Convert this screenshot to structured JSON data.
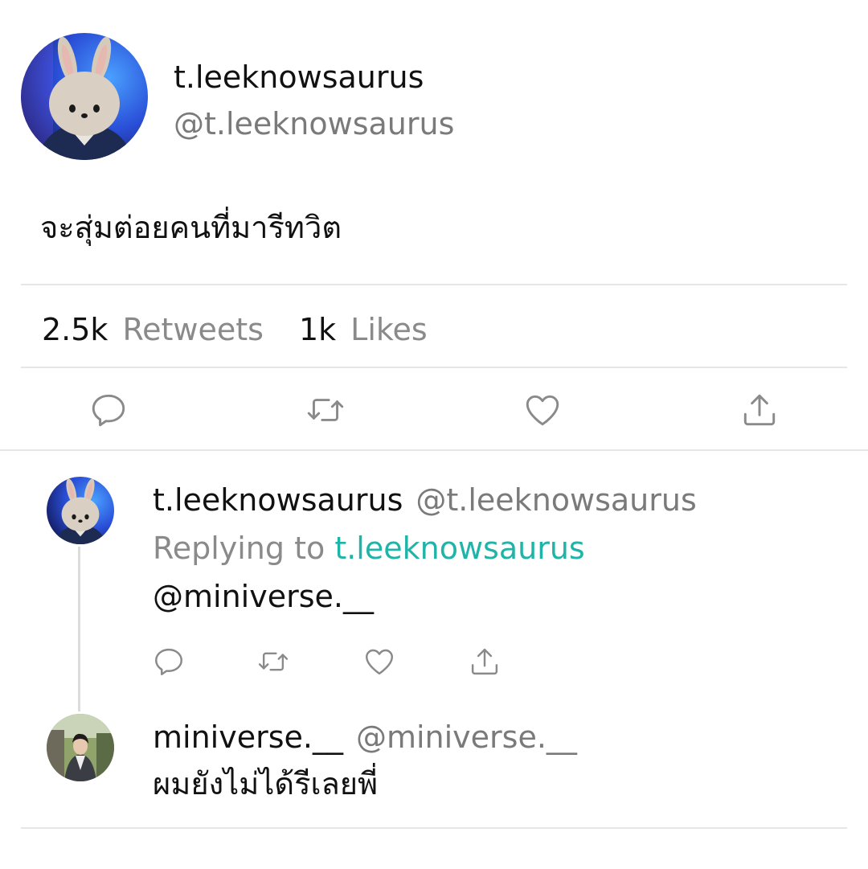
{
  "main_tweet": {
    "display_name": "t.leeknowsaurus",
    "handle": "@t.leeknowsaurus",
    "text": "จะสุ่มต่อยคนที่มารีทวิต",
    "avatar": "bunny-mascot-avatar",
    "stats": {
      "retweets_count": "2.5k",
      "retweets_label": "Retweets",
      "likes_count": "1k",
      "likes_label": "Likes"
    },
    "actions": [
      "reply-icon",
      "retweet-icon",
      "like-icon",
      "share-icon"
    ]
  },
  "replies": [
    {
      "display_name": "t.leeknowsaurus",
      "handle": "@t.leeknowsaurus",
      "replying_prefix": "Replying to",
      "replying_to": "t.leeknowsaurus",
      "text": "@miniverse.__",
      "avatar": "bunny-mascot-avatar",
      "actions": [
        "reply-icon",
        "retweet-icon",
        "like-icon",
        "share-icon"
      ]
    },
    {
      "display_name": "miniverse.__",
      "handle": "@miniverse.__",
      "text": "ผมยังไม่ได้รีเลยพี่",
      "avatar": "person-photo-avatar"
    }
  ],
  "colors": {
    "text": "#111111",
    "secondary": "#7a7a7a",
    "link": "#20b3a8",
    "divider": "#e6e6e6",
    "icon": "#8a8a8a"
  }
}
